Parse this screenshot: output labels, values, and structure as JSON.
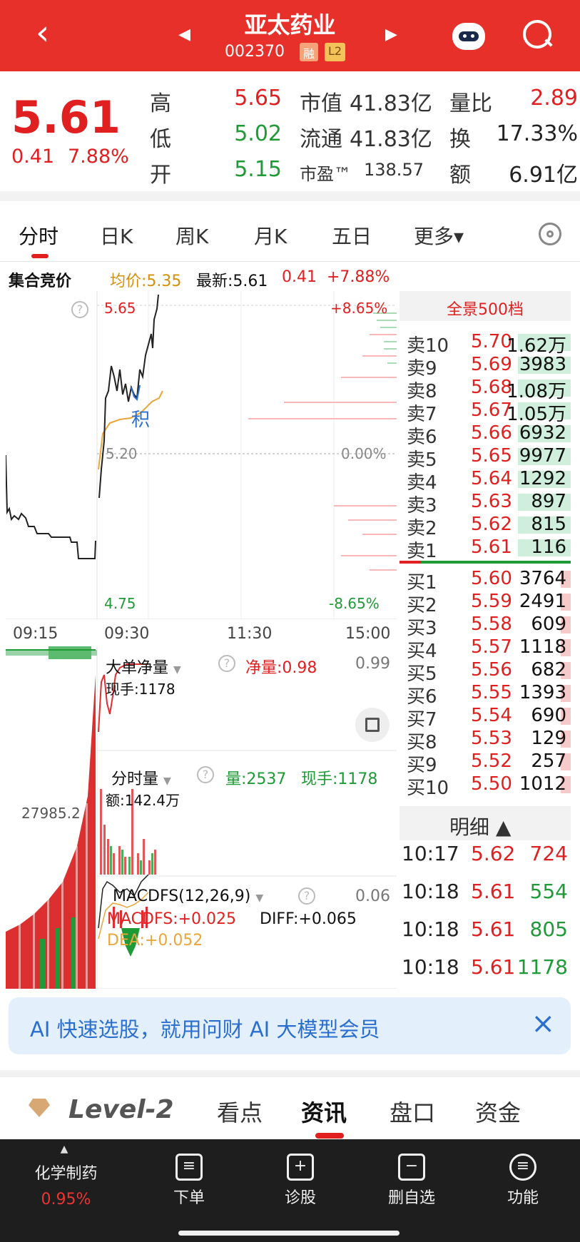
{
  "header": {
    "back_icon": "chevron-left-icon",
    "title": "亚太药业",
    "code": "002370",
    "tag_margin": "融",
    "tag_level": "L2",
    "prev_icon": "triangle-left-icon",
    "next_icon": "triangle-right-icon",
    "robot_icon": "robot-icon",
    "search_icon": "search-icon",
    "brand_color": "#e8302a"
  },
  "quote": {
    "price": "5.61",
    "change": "0.41",
    "change_pct": "7.88%",
    "high_label": "高",
    "high": "5.65",
    "low_label": "低",
    "low": "5.02",
    "open_label": "开",
    "open": "5.15",
    "mcap_label": "市值",
    "mcap": "41.83亿",
    "float_label": "流通",
    "float": "41.83亿",
    "pe_label": "市盈™",
    "pe": "138.57",
    "vr_label": "量比",
    "vr": "2.89",
    "turn_label": "换",
    "turn": "17.33%",
    "amount_label": "额",
    "amount": "6.91亿"
  },
  "period_tabs": [
    "分时",
    "日K",
    "周K",
    "月K",
    "五日",
    "更多▾"
  ],
  "chart_info": {
    "auction_label": "集合竞价",
    "avg": "均价:5.35",
    "latest": "最新:5.61",
    "chg": "0.41",
    "chg_pct": "+7.88%",
    "y_top": "5.65",
    "y_mid": "5.20",
    "y_bot": "4.75",
    "pct_top": "+8.65%",
    "pct_mid": "0.00%",
    "pct_bot": "-8.65%",
    "marker": "积",
    "times": [
      "09:15",
      "09:30",
      "11:30",
      "15:00"
    ],
    "auction_vol": "27985.2"
  },
  "big_order": {
    "dropdown": "大单净量",
    "net": "净量:0.98",
    "current": "现手:1178",
    "max": "0.99"
  },
  "volume": {
    "dropdown": "分时量",
    "vol": "量:2537",
    "current": "现手:1178",
    "amount": "额:142.4万"
  },
  "macd": {
    "dropdown": "MACDFS(12,26,9)",
    "macdfs": "MACDFS:+0.025",
    "diff": "DIFF:+0.065",
    "dea": "DEA:+0.052",
    "max": "0.06"
  },
  "orderbook": {
    "header": "全景500档",
    "asks": [
      {
        "n": "卖10",
        "p": "5.70",
        "v": "1.62万"
      },
      {
        "n": "卖9",
        "p": "5.69",
        "v": "3983"
      },
      {
        "n": "卖8",
        "p": "5.68",
        "v": "1.08万"
      },
      {
        "n": "卖7",
        "p": "5.67",
        "v": "1.05万"
      },
      {
        "n": "卖6",
        "p": "5.66",
        "v": "6932"
      },
      {
        "n": "卖5",
        "p": "5.65",
        "v": "9977"
      },
      {
        "n": "卖4",
        "p": "5.64",
        "v": "1292"
      },
      {
        "n": "卖3",
        "p": "5.63",
        "v": "897"
      },
      {
        "n": "卖2",
        "p": "5.62",
        "v": "815"
      },
      {
        "n": "卖1",
        "p": "5.61",
        "v": "116"
      }
    ],
    "bids": [
      {
        "n": "买1",
        "p": "5.60",
        "v": "3764"
      },
      {
        "n": "买2",
        "p": "5.59",
        "v": "2491"
      },
      {
        "n": "买3",
        "p": "5.58",
        "v": "609"
      },
      {
        "n": "买4",
        "p": "5.57",
        "v": "1118"
      },
      {
        "n": "买5",
        "p": "5.56",
        "v": "682"
      },
      {
        "n": "买6",
        "p": "5.55",
        "v": "1393"
      },
      {
        "n": "买7",
        "p": "5.54",
        "v": "690"
      },
      {
        "n": "买8",
        "p": "5.53",
        "v": "129"
      },
      {
        "n": "买9",
        "p": "5.52",
        "v": "257"
      },
      {
        "n": "买10",
        "p": "5.50",
        "v": "1012"
      }
    ]
  },
  "ticks": {
    "header": "明细 ▲",
    "rows": [
      {
        "t": "10:17",
        "p": "5.62",
        "v": "724",
        "dir": "red"
      },
      {
        "t": "10:18",
        "p": "5.61",
        "v": "554",
        "dir": "green"
      },
      {
        "t": "10:18",
        "p": "5.61",
        "v": "805",
        "dir": "green"
      },
      {
        "t": "10:18",
        "p": "5.61",
        "v": "1178",
        "dir": "green"
      }
    ]
  },
  "banner": {
    "text": "AI 快速选股，就用问财 AI 大模型会员",
    "close": "×"
  },
  "bottom_tabs": [
    "Level-2",
    "看点",
    "资讯",
    "盘口",
    "资金"
  ],
  "nav": {
    "sector": "化学制药",
    "sector_chg": "0.95%",
    "items": [
      "下单",
      "诊股",
      "删自选",
      "功能"
    ]
  }
}
